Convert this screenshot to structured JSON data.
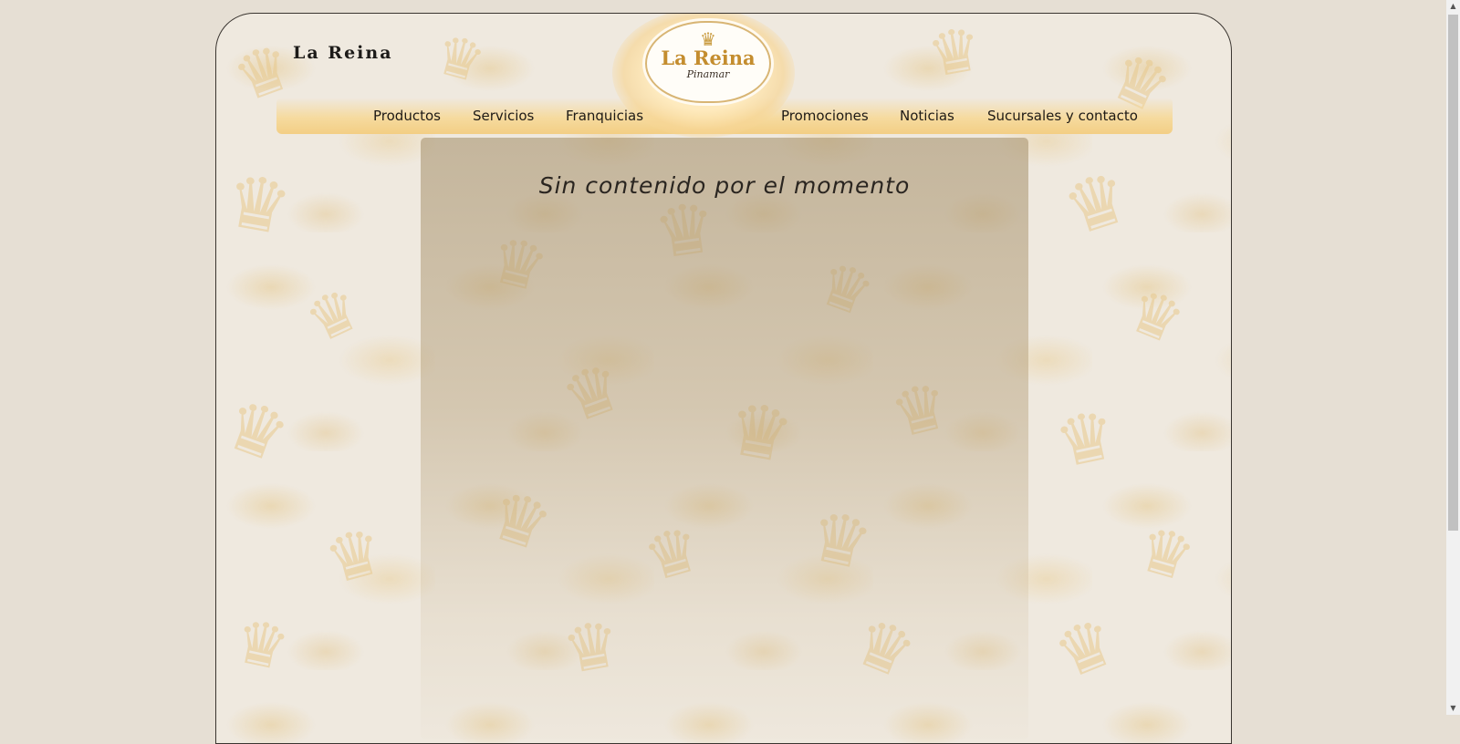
{
  "header": {
    "brand_text": "La Reina",
    "logo": {
      "name": "La Reina",
      "subtitle": "Pinamar",
      "icon": "crown-icon"
    }
  },
  "nav": {
    "items": [
      {
        "label": "Productos"
      },
      {
        "label": "Servicios"
      },
      {
        "label": "Franquicias"
      },
      {
        "label": "Promociones"
      },
      {
        "label": "Noticias"
      },
      {
        "label": "Sucursales y contacto"
      }
    ]
  },
  "main": {
    "message": "Sin contenido por el momento"
  },
  "colors": {
    "accent": "#f3cd80",
    "logo_gold": "#c48d2f",
    "page_background": "#e6dfd4"
  }
}
